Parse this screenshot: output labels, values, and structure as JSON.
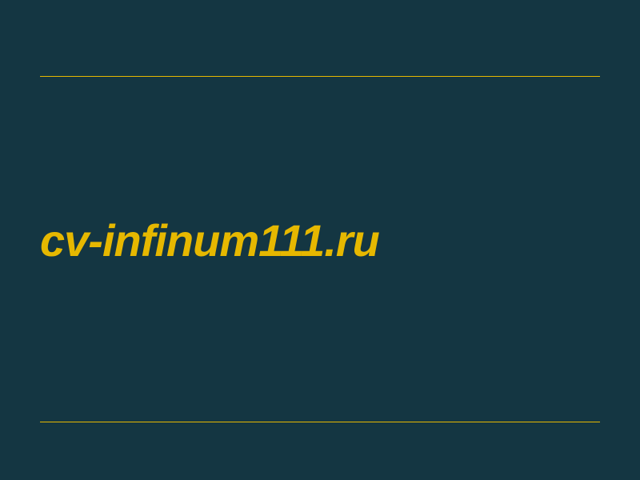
{
  "main": {
    "domain_name": "cv-infinum111.ru"
  },
  "colors": {
    "background": "#143642",
    "accent": "#e6b800"
  }
}
